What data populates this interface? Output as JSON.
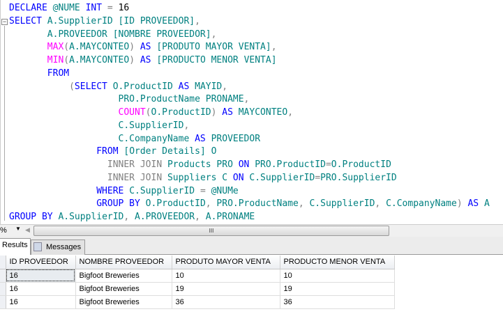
{
  "editor": {
    "lines": [
      [
        [
          "kw",
          "DECLARE "
        ],
        [
          "id",
          "@NUME "
        ],
        [
          "kw",
          "INT "
        ],
        [
          "op",
          "= "
        ],
        [
          "num",
          "16"
        ]
      ],
      [
        [
          "kw",
          "SELECT "
        ],
        [
          "id",
          "A.SupplierID [ID PROVEEDOR]"
        ],
        [
          "op",
          ","
        ]
      ],
      [
        [
          "id",
          "       A.PROVEEDOR [NOMBRE PROVEEDOR]"
        ],
        [
          "op",
          ","
        ]
      ],
      [
        [
          "fn",
          "       MAX"
        ],
        [
          "op",
          "("
        ],
        [
          "id",
          "A.MAYCONTEO"
        ],
        [
          "op",
          ") "
        ],
        [
          "kw",
          "AS "
        ],
        [
          "id",
          "[PRODUTO MAYOR VENTA]"
        ],
        [
          "op",
          ","
        ]
      ],
      [
        [
          "fn",
          "       MIN"
        ],
        [
          "op",
          "("
        ],
        [
          "id",
          "A.MAYCONTEO"
        ],
        [
          "op",
          ") "
        ],
        [
          "kw",
          "AS "
        ],
        [
          "id",
          "[PRODUCTO MENOR VENTA]"
        ]
      ],
      [
        [
          "kw",
          "       FROM"
        ]
      ],
      [
        [
          "op",
          "           ("
        ],
        [
          "kw",
          "SELECT "
        ],
        [
          "id",
          "O.ProductID "
        ],
        [
          "kw",
          "AS "
        ],
        [
          "id",
          "MAYID"
        ],
        [
          "op",
          ","
        ]
      ],
      [
        [
          "id",
          "                    PRO.ProductName PRONAME"
        ],
        [
          "op",
          ","
        ]
      ],
      [
        [
          "fn",
          "                    COUNT"
        ],
        [
          "op",
          "("
        ],
        [
          "id",
          "O.ProductID"
        ],
        [
          "op",
          ") "
        ],
        [
          "kw",
          "AS "
        ],
        [
          "id",
          "MAYCONTEO"
        ],
        [
          "op",
          ","
        ]
      ],
      [
        [
          "id",
          "                    C.SupplierID"
        ],
        [
          "op",
          ","
        ]
      ],
      [
        [
          "id",
          "                    C.CompanyName "
        ],
        [
          "kw",
          "AS "
        ],
        [
          "id",
          "PROVEEDOR"
        ]
      ],
      [
        [
          "kw",
          "                FROM "
        ],
        [
          "id",
          "[Order Details] O"
        ]
      ],
      [
        [
          "op",
          "                  INNER JOIN "
        ],
        [
          "id",
          "Products PRO "
        ],
        [
          "kw",
          "ON "
        ],
        [
          "id",
          "PRO.ProductID"
        ],
        [
          "op",
          "="
        ],
        [
          "id",
          "O.ProductID"
        ]
      ],
      [
        [
          "op",
          "                  INNER JOIN "
        ],
        [
          "id",
          "Suppliers C "
        ],
        [
          "kw",
          "ON "
        ],
        [
          "id",
          "C.SupplierID"
        ],
        [
          "op",
          "="
        ],
        [
          "id",
          "PRO.SupplierID"
        ]
      ],
      [
        [
          "kw",
          "                WHERE "
        ],
        [
          "id",
          "C.SupplierID "
        ],
        [
          "op",
          "= "
        ],
        [
          "id",
          "@NUMe"
        ]
      ],
      [
        [
          "kw",
          "                GROUP BY "
        ],
        [
          "id",
          "O.ProductID"
        ],
        [
          "op",
          ", "
        ],
        [
          "id",
          "PRO.ProductName"
        ],
        [
          "op",
          ", "
        ],
        [
          "id",
          "C.SupplierID"
        ],
        [
          "op",
          ", "
        ],
        [
          "id",
          "C.CompanyName"
        ],
        [
          "op",
          ") "
        ],
        [
          "kw",
          "AS "
        ],
        [
          "id",
          "A"
        ]
      ],
      [
        [
          "kw",
          "GROUP BY "
        ],
        [
          "id",
          "A.SupplierID"
        ],
        [
          "op",
          ", "
        ],
        [
          "id",
          "A.PROVEEDOR"
        ],
        [
          "op",
          ", "
        ],
        [
          "id",
          "A.PRONAME"
        ]
      ]
    ]
  },
  "statusbar": {
    "zoom": "%",
    "scroll_thumb": "III"
  },
  "tabs": {
    "results": "Results",
    "messages": "Messages"
  },
  "grid": {
    "columns": [
      "ID PROVEEDOR",
      "NOMBRE PROVEEDOR",
      "PRODUTO MAYOR VENTA",
      "PRODUCTO MENOR VENTA"
    ],
    "rows": [
      [
        "16",
        "Bigfoot Breweries",
        "10",
        "10"
      ],
      [
        "16",
        "Bigfoot Breweries",
        "19",
        "19"
      ],
      [
        "16",
        "Bigfoot Breweries",
        "36",
        "36"
      ]
    ]
  }
}
